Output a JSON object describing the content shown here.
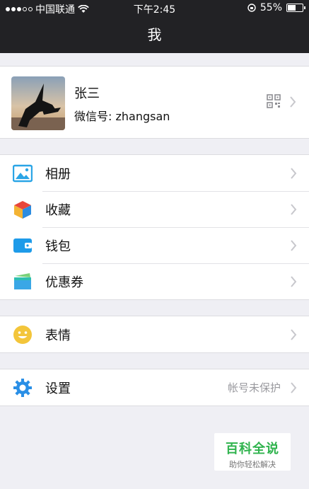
{
  "status_bar": {
    "carrier": "中国联通",
    "time": "下午2:45",
    "battery_text": "55%",
    "battery_level": 0.55,
    "signal_bars_filled": 3,
    "signal_bars_total": 5
  },
  "nav": {
    "title": "我"
  },
  "profile": {
    "name": "张三",
    "wechat_id": "微信号: zhangsan",
    "icons": [
      "qr-code-icon",
      "chevron-right-icon"
    ]
  },
  "menu_groups": [
    [
      {
        "label": "相册",
        "icon": "album-icon",
        "icon_color": "#2aa5e6"
      },
      {
        "label": "收藏",
        "icon": "favorites-cube-icon",
        "icon_color": "#e8463b"
      },
      {
        "label": "钱包",
        "icon": "wallet-icon",
        "icon_color": "#1e9be9"
      },
      {
        "label": "优惠券",
        "icon": "coupon-icon",
        "icon_color": "#2dbfb0"
      }
    ],
    [
      {
        "label": "表情",
        "icon": "smiley-icon",
        "icon_color": "#f3c53a"
      }
    ],
    [
      {
        "label": "设置",
        "icon": "gear-icon",
        "icon_color": "#2a8fe6",
        "note": "帐号未保护"
      }
    ]
  ],
  "watermark": {
    "title": "百科全说",
    "subtitle": "助你轻松解决"
  },
  "colors": {
    "bar_bg": "#222225",
    "page_bg": "#efeff4",
    "chevron": "#c7c7cc",
    "watermark_green": "#2fb34d"
  }
}
